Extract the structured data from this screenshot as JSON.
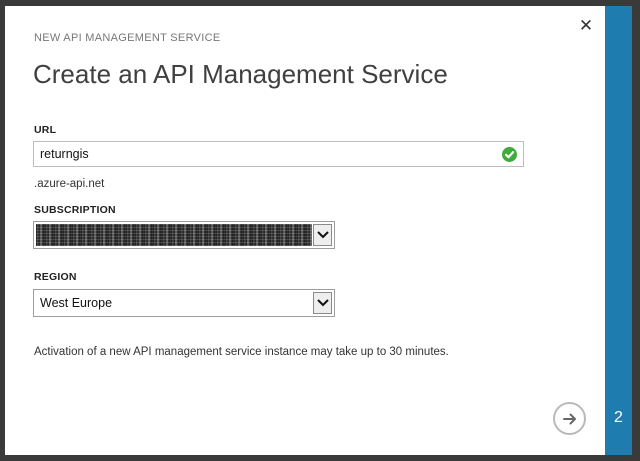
{
  "dialog": {
    "eyebrow": "NEW API MANAGEMENT SERVICE",
    "title": "Create an API Management Service",
    "close_icon": "close-icon"
  },
  "url": {
    "label": "URL",
    "value": "returngis",
    "suffix": ".azure-api.net",
    "status_icon": "check-circle-icon"
  },
  "subscription": {
    "label": "SUBSCRIPTION",
    "value": "",
    "dropdown_icon": "chevron-down-icon"
  },
  "region": {
    "label": "REGION",
    "value": "West Europe",
    "dropdown_icon": "chevron-down-icon"
  },
  "note": "Activation of a new API management service instance may take up to 30 minutes.",
  "next_icon": "arrow-right-circle-icon",
  "step": {
    "number": "2"
  },
  "colors": {
    "stepbar": "#1f7cae",
    "success": "#3fab3a"
  }
}
